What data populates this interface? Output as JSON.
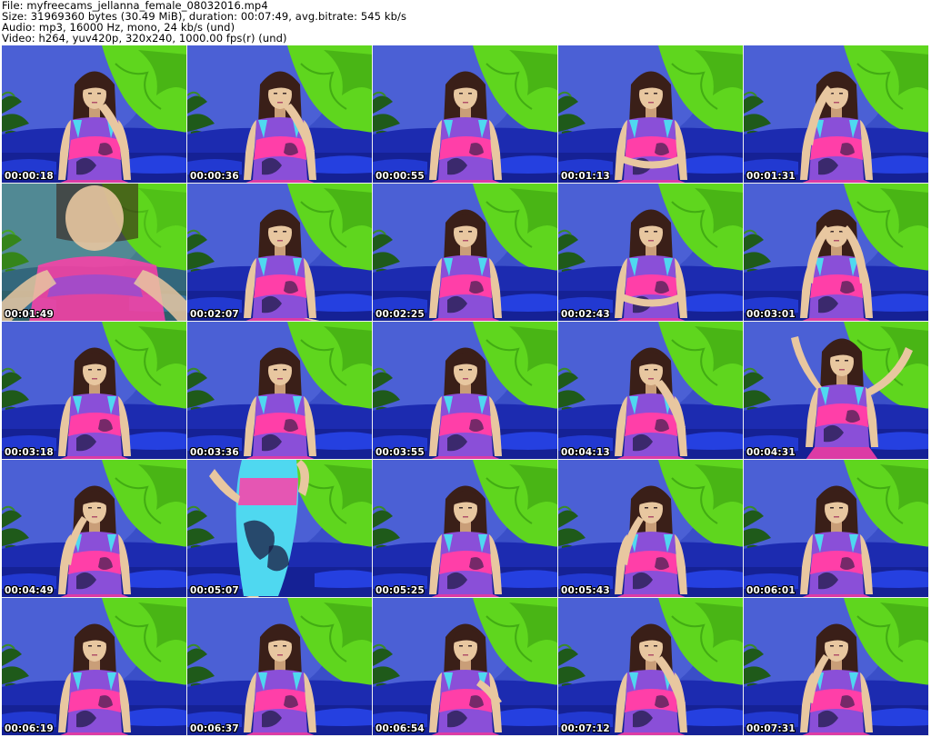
{
  "header": {
    "file_line": "File: myfreecams_jellanna_female_08032016.mp4",
    "size_line": "Size: 31969360 bytes (30.49 MiB), duration: 00:07:49, avg.bitrate: 545 kb/s",
    "audio_line": "Audio: mp3, 16000 Hz, mono, 24 kb/s (und)",
    "video_line": "Video: h264, yuv420p, 320x240, 1000.00 fps(r) (und)"
  },
  "thumbnails": [
    {
      "time": "00:00:18",
      "pose": "hand-chin"
    },
    {
      "time": "00:00:36",
      "pose": "hand-chin"
    },
    {
      "time": "00:00:55",
      "pose": "looking-down"
    },
    {
      "time": "00:01:13",
      "pose": "arm-across"
    },
    {
      "time": "00:01:31",
      "pose": "hand-head"
    },
    {
      "time": "00:01:49",
      "pose": "close-blur"
    },
    {
      "time": "00:02:07",
      "pose": "leaning"
    },
    {
      "time": "00:02:25",
      "pose": "looking-down"
    },
    {
      "time": "00:02:43",
      "pose": "arm-across"
    },
    {
      "time": "00:03:01",
      "pose": "hands-head"
    },
    {
      "time": "00:03:18",
      "pose": "looking-down"
    },
    {
      "time": "00:03:36",
      "pose": "looking-down"
    },
    {
      "time": "00:03:55",
      "pose": "looking-down"
    },
    {
      "time": "00:04:13",
      "pose": "hand-mouth"
    },
    {
      "time": "00:04:31",
      "pose": "arms-up"
    },
    {
      "time": "00:04:49",
      "pose": "hand-cheek"
    },
    {
      "time": "00:05:07",
      "pose": "standing"
    },
    {
      "time": "00:05:25",
      "pose": "looking-down"
    },
    {
      "time": "00:05:43",
      "pose": "hand-cheek"
    },
    {
      "time": "00:06:01",
      "pose": "looking-down"
    },
    {
      "time": "00:06:19",
      "pose": "looking-down"
    },
    {
      "time": "00:06:37",
      "pose": "looking-down"
    },
    {
      "time": "00:06:54",
      "pose": "hand-chest"
    },
    {
      "time": "00:07:12",
      "pose": "hand-chin"
    },
    {
      "time": "00:07:31",
      "pose": "hand-cheek"
    }
  ],
  "colors": {
    "wall_blue": "#3a4fc8",
    "wall_blue_light": "#5a6fe0",
    "sofa_blue": "#1c2bb0",
    "sofa_dark": "#111a80",
    "leaf_green": "#5fd61e",
    "leaf_green_dark": "#2f8f0c",
    "plant_dark": "#1f5a1a",
    "skin": "#e8c7a0",
    "skin_shadow": "#c99e78",
    "hair": "#3a1f18",
    "dress_pink": "#ff3fa8",
    "dress_purple": "#8a4fd8",
    "dress_cyan": "#4fd8f0",
    "dress_dark": "#1a1a40"
  }
}
